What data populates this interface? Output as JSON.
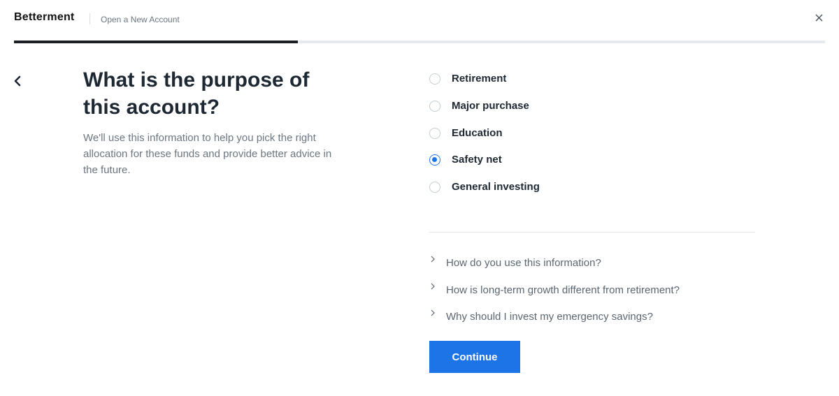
{
  "header": {
    "logo": "Betterment",
    "title": "Open a New Account",
    "close_icon": "close-icon"
  },
  "progress": {
    "fraction": 0.35
  },
  "question": {
    "title": "What is the purpose of this account?",
    "description": "We'll use this information to help you pick the right allocation for these funds and provide better advice in the future."
  },
  "options": [
    {
      "label": "Retirement",
      "selected": false
    },
    {
      "label": "Major purchase",
      "selected": false
    },
    {
      "label": "Education",
      "selected": false
    },
    {
      "label": "Safety net",
      "selected": true
    },
    {
      "label": "General investing",
      "selected": false
    }
  ],
  "faq": [
    {
      "label": "How do you use this information?"
    },
    {
      "label": "How is long-term growth different from retirement?"
    },
    {
      "label": "Why should I invest my emergency savings?"
    }
  ],
  "actions": {
    "continue_label": "Continue"
  },
  "colors": {
    "accent": "#1d74e6",
    "text": "#1e2833",
    "muted": "#6c7680",
    "progress": "#1b1f24"
  }
}
